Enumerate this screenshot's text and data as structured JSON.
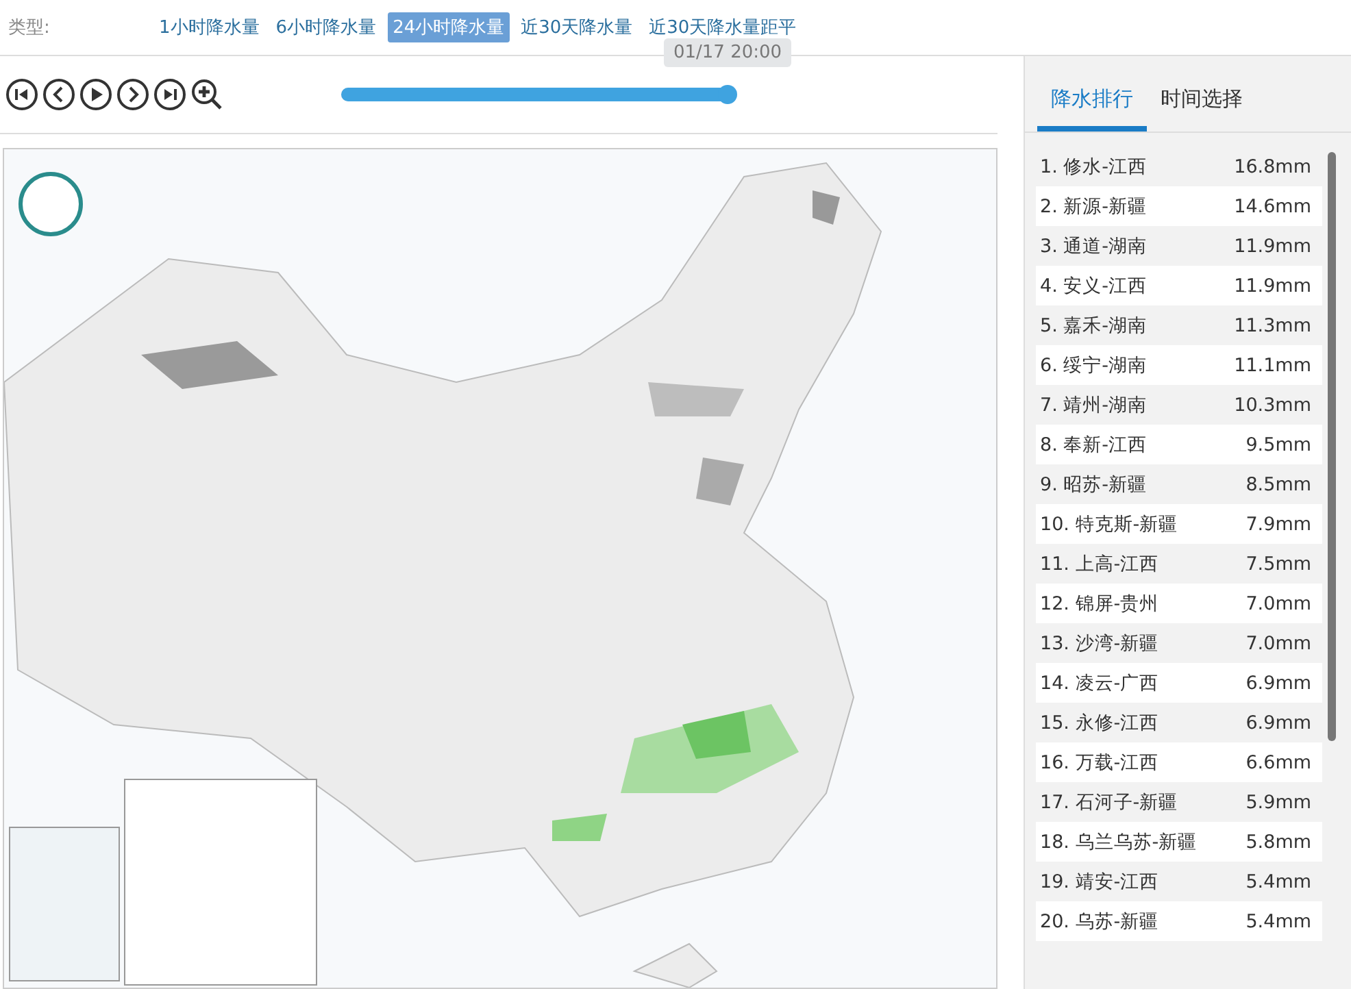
{
  "type_bar": {
    "label": "类型:",
    "options": [
      {
        "label": "1小时降水量",
        "selected": false
      },
      {
        "label": "6小时降水量",
        "selected": false
      },
      {
        "label": "24小时降水量",
        "selected": true
      },
      {
        "label": "近30天降水量",
        "selected": false
      },
      {
        "label": "近30天降水量距平",
        "selected": false
      }
    ]
  },
  "timeline": {
    "level": 1.0,
    "time_label": "01/17 20:00"
  },
  "side_tabs": [
    {
      "label": "降水排行",
      "selected": true
    },
    {
      "label": "时间选择",
      "selected": false
    }
  ],
  "ranking": [
    {
      "name": "1. 修水-江西",
      "value": "16.8mm"
    },
    {
      "name": "2. 新源-新疆",
      "value": "14.6mm"
    },
    {
      "name": "3. 通道-湖南",
      "value": "11.9mm"
    },
    {
      "name": "4. 安义-江西",
      "value": "11.9mm"
    },
    {
      "name": "5. 嘉禾-湖南",
      "value": "11.3mm"
    },
    {
      "name": "6. 绥宁-湖南",
      "value": "11.1mm"
    },
    {
      "name": "7. 靖州-湖南",
      "value": "10.3mm"
    },
    {
      "name": "8. 奉新-江西",
      "value": "9.5mm"
    },
    {
      "name": "9. 昭苏-新疆",
      "value": "8.5mm"
    },
    {
      "name": "10. 特克斯-新疆",
      "value": "7.9mm"
    },
    {
      "name": "11. 上高-江西",
      "value": "7.5mm"
    },
    {
      "name": "12. 锦屏-贵州",
      "value": "7.0mm"
    },
    {
      "name": "13. 沙湾-新疆",
      "value": "7.0mm"
    },
    {
      "name": "14. 凌云-广西",
      "value": "6.9mm"
    },
    {
      "name": "15. 永修-江西",
      "value": "6.9mm"
    },
    {
      "name": "16. 万载-江西",
      "value": "6.6mm"
    },
    {
      "name": "17. 石河子-新疆",
      "value": "5.9mm"
    },
    {
      "name": "18. 乌兰乌苏-新疆",
      "value": "5.8mm"
    },
    {
      "name": "19. 靖安-江西",
      "value": "5.4mm"
    },
    {
      "name": "20. 乌苏-新疆",
      "value": "5.4mm"
    }
  ]
}
